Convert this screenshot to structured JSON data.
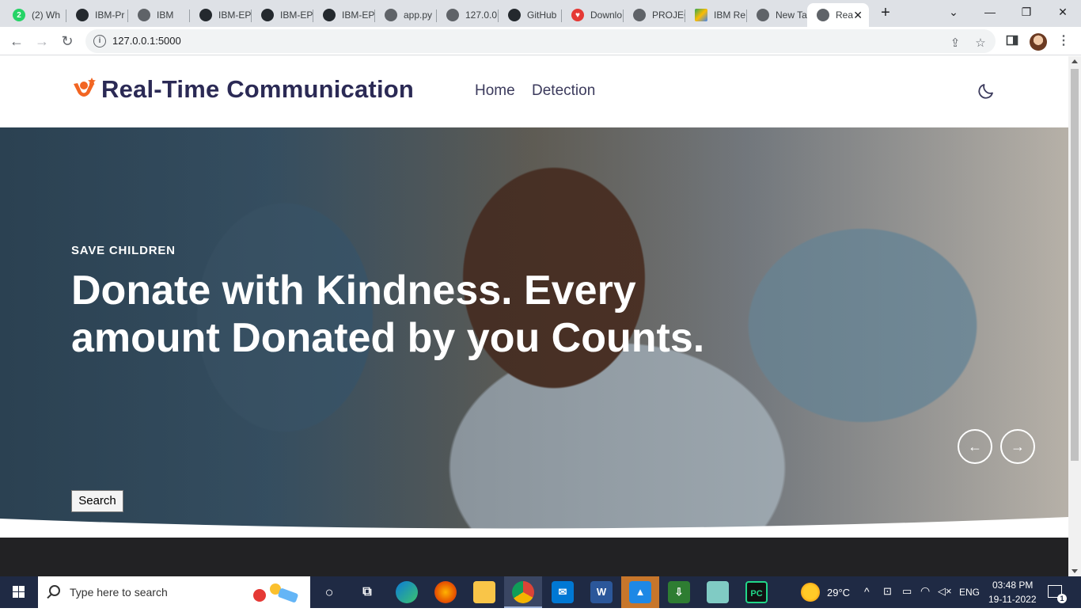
{
  "browser": {
    "tabs": [
      {
        "label": "(2) Wh",
        "icon": "whatsapp-icon",
        "color": "#25d366"
      },
      {
        "label": "IBM-Pr",
        "icon": "github-icon",
        "color": "#24292e"
      },
      {
        "label": "IBM",
        "icon": "globe-icon",
        "color": "#5f6368"
      },
      {
        "label": "IBM-EP",
        "icon": "github-icon",
        "color": "#24292e"
      },
      {
        "label": "IBM-EP",
        "icon": "github-icon",
        "color": "#24292e"
      },
      {
        "label": "IBM-EP",
        "icon": "github-icon",
        "color": "#24292e"
      },
      {
        "label": "app.py",
        "icon": "globe-icon",
        "color": "#5f6368"
      },
      {
        "label": "127.0.0",
        "icon": "globe-icon",
        "color": "#5f6368"
      },
      {
        "label": "GitHub",
        "icon": "github-icon",
        "color": "#24292e"
      },
      {
        "label": "Downlo",
        "icon": "heart-icon",
        "color": "#e53935"
      },
      {
        "label": "PROJEC",
        "icon": "globe-icon",
        "color": "#5f6368"
      },
      {
        "label": "IBM Re",
        "icon": "drive-icon",
        "color": "#fbbc04"
      },
      {
        "label": "New Ta",
        "icon": "chrome-icon",
        "color": "#5f6368"
      },
      {
        "label": "Rea",
        "icon": "globe-icon",
        "color": "#5f6368"
      }
    ],
    "url": "127.0.0.1:5000"
  },
  "site": {
    "brand": "Real-Time Communication",
    "nav": [
      "Home",
      "Detection"
    ],
    "accent_color": "#f26522",
    "brand_color": "#2b2a55"
  },
  "hero": {
    "subtitle": "SAVE CHILDREN",
    "title": "Donate with Kindness. Every amount Donated by you Counts.",
    "prev_icon": "←",
    "next_icon": "→",
    "search_label": "Search"
  },
  "taskbar": {
    "search_placeholder": "Type here to search",
    "weather": "29°C",
    "language": "ENG",
    "time": "03:48 PM",
    "date": "19-11-2022",
    "notification_count": "1"
  }
}
